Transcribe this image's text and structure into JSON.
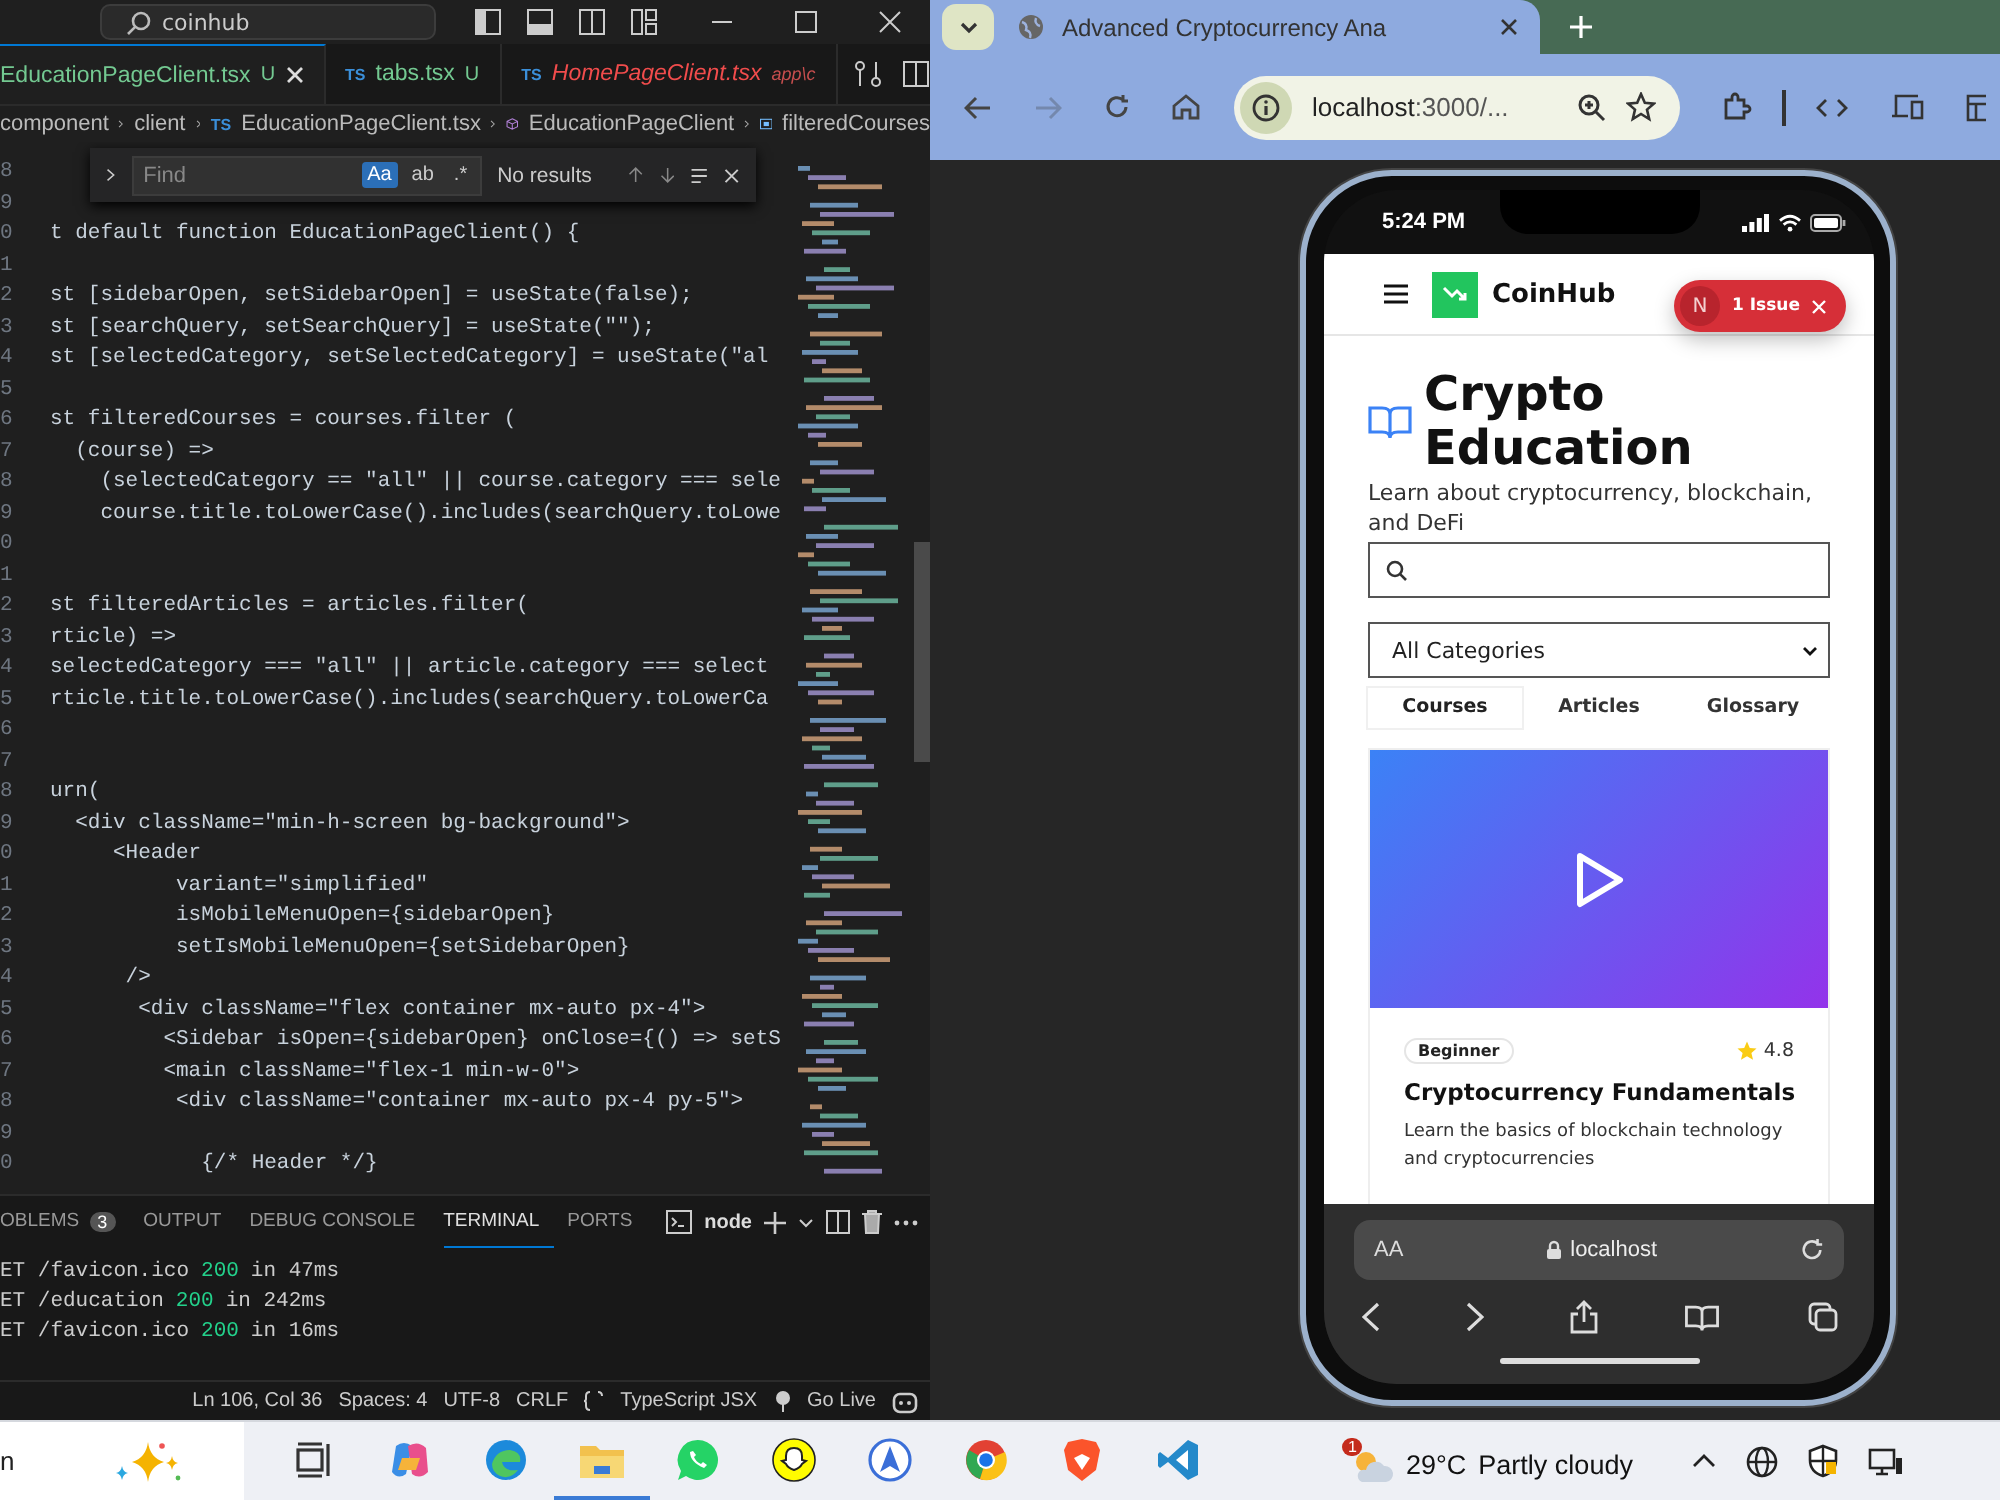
{
  "editor": {
    "search": "coinhub",
    "tabs": [
      {
        "name": "EducationPageClient.tsx",
        "badge": "U",
        "selected": true,
        "error": false
      },
      {
        "type": "TS",
        "name": "tabs.tsx",
        "badge": "U",
        "selected": false,
        "error": false
      },
      {
        "type": "TS",
        "name": "HomePageClient.tsx",
        "path": "app\\c",
        "selected": false,
        "error": true
      }
    ],
    "breadcrumbs": [
      {
        "kind": "folder",
        "text": "component"
      },
      {
        "kind": "folder",
        "text": "client"
      },
      {
        "kind": "file",
        "type": "TS",
        "text": "EducationPageClient.tsx"
      },
      {
        "kind": "function",
        "text": "EducationPageClient"
      },
      {
        "kind": "variable",
        "text": "filteredCourses"
      }
    ],
    "find": {
      "placeholder": "Find",
      "options": [
        {
          "label": "Aa",
          "selected": true
        },
        {
          "label": "ab",
          "selected": false
        },
        {
          "label": ".*",
          "selected": false
        }
      ],
      "result": "No results"
    },
    "lines": [
      {
        "number": "8"
      },
      {
        "number": "9"
      },
      {
        "number": "0",
        "text": "t default function EducationPageClient() {"
      },
      {
        "number": "1"
      },
      {
        "number": "2",
        "text": "st [sidebarOpen, setSidebarOpen] = useState(false);"
      },
      {
        "number": "3",
        "text": "st [searchQuery, setSearchQuery] = useState(\"\");"
      },
      {
        "number": "4",
        "text": "st [selectedCategory, setSelectedCategory] = useState(\"al"
      },
      {
        "number": "5"
      },
      {
        "number": "6",
        "text": "st filteredCourses = courses.filter ("
      },
      {
        "number": "7",
        "text": "  (course) =>"
      },
      {
        "number": "8",
        "text": "    (selectedCategory == \"all\" || course.category === sele"
      },
      {
        "number": "9",
        "text": "    course.title.toLowerCase().includes(searchQuery.toLowe"
      },
      {
        "number": "0"
      },
      {
        "number": "1"
      },
      {
        "number": "2",
        "text": "st filteredArticles = articles.filter("
      },
      {
        "number": "3",
        "text": "rticle) =>"
      },
      {
        "number": "4",
        "text": "selectedCategory === \"all\" || article.category === select"
      },
      {
        "number": "5",
        "text": "rticle.title.toLowerCase().includes(searchQuery.toLowerCa"
      },
      {
        "number": "6"
      },
      {
        "number": "7"
      },
      {
        "number": "8",
        "text": "urn("
      },
      {
        "number": "9",
        "text": "  <div className=\"min-h-screen bg-background\">"
      },
      {
        "number": "0",
        "text": "     <Header"
      },
      {
        "number": "1",
        "text": "          variant=\"simplified\""
      },
      {
        "number": "2",
        "text": "          isMobileMenuOpen={sidebarOpen}"
      },
      {
        "number": "3",
        "text": "          setIsMobileMenuOpen={setSidebarOpen}"
      },
      {
        "number": "4",
        "text": "      />"
      },
      {
        "number": "5",
        "text": "       <div className=\"flex container mx-auto px-4\">"
      },
      {
        "number": "6",
        "text": "         <Sidebar isOpen={sidebarOpen} onClose={() => setS"
      },
      {
        "number": "7",
        "text": "         <main className=\"flex-1 min-w-0\">"
      },
      {
        "number": "8",
        "text": "          <div className=\"container mx-auto px-4 py-5\">"
      },
      {
        "number": "9"
      },
      {
        "number": "0",
        "text": "            {/* Header */}"
      }
    ],
    "panel": {
      "tabs": [
        {
          "label": "OBLEMS",
          "count": "3",
          "selected": false
        },
        {
          "label": "OUTPUT",
          "selected": false
        },
        {
          "label": "DEBUG CONSOLE",
          "selected": false
        },
        {
          "label": "TERMINAL",
          "selected": true
        },
        {
          "label": "PORTS",
          "selected": false
        }
      ],
      "shell": "node",
      "output": [
        {
          "request": "ET /favicon.ico",
          "status": "200",
          "rest": "in 47ms"
        },
        {
          "request": "ET /education",
          "status": "200",
          "rest": "in 242ms"
        },
        {
          "request": "ET /favicon.ico",
          "status": "200",
          "rest": "in 16ms"
        }
      ]
    },
    "status_bar": [
      "Ln 106, Col 36",
      "Spaces: 4",
      "UTF-8",
      "CRLF",
      "TypeScript JSX",
      "Go Live"
    ]
  },
  "browser": {
    "tab_title": "Advanced Cryptocurrency Ana",
    "address": {
      "host": "localhost",
      "rest": ":3000/..."
    },
    "phone": {
      "time": "5:24 PM",
      "brand": "CoinHub",
      "issue": {
        "initial": "N",
        "label": "1 Issue"
      },
      "title": "Crypto Education",
      "subtitle": "Learn about cryptocurrency, blockchain, and DeFi",
      "category": "All Categories",
      "tabs": [
        {
          "label": "Courses",
          "selected": true
        },
        {
          "label": "Articles",
          "selected": false
        },
        {
          "label": "Glossary",
          "selected": false
        }
      ],
      "course": {
        "difficulty": "Beginner",
        "rating": "4.8",
        "title": "Cryptocurrency Fundamentals",
        "description": "Learn the basics of blockchain technology and cryptocurrencies"
      },
      "safari": {
        "text_size": "AA",
        "url": "localhost"
      }
    }
  },
  "taskbar": {
    "search": "n",
    "apps": [
      {
        "kind": "taskview",
        "selected": false
      },
      {
        "kind": "copilot",
        "selected": false
      },
      {
        "kind": "edge",
        "selected": false
      },
      {
        "kind": "files",
        "selected": true
      },
      {
        "kind": "whatsapp",
        "selected": false
      },
      {
        "kind": "snapchat",
        "selected": false
      },
      {
        "kind": "compass",
        "selected": false
      },
      {
        "kind": "chrome",
        "selected": false
      },
      {
        "kind": "brave",
        "selected": false
      },
      {
        "kind": "vscode",
        "selected": false
      }
    ],
    "weather": {
      "badge": "1",
      "temperature": "29°C",
      "condition": "Partly cloudy"
    }
  }
}
